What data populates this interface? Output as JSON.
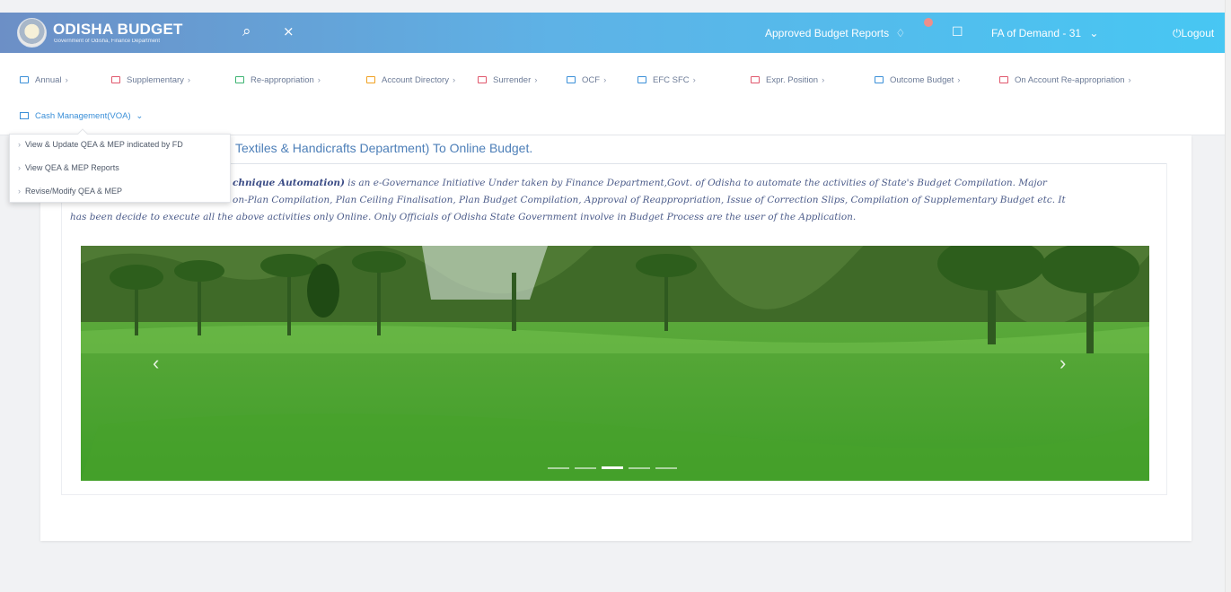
{
  "header": {
    "brand_title": "ODISHA BUDGET",
    "brand_subtitle": "Government of Odisha, Finance Department",
    "approved_reports": "Approved Budget Reports",
    "user_menu": "FA of Demand - 31",
    "logout": "Logout"
  },
  "nav": {
    "items": [
      {
        "label": "Annual",
        "color": "#3a8fd8"
      },
      {
        "label": "Supplementary",
        "color": "#e0566b"
      },
      {
        "label": "Re-appropriation",
        "color": "#3cb371"
      },
      {
        "label": "Account Directory",
        "color": "#f0a020"
      },
      {
        "label": "Surrender",
        "color": "#e0566b"
      },
      {
        "label": "OCF",
        "color": "#3a8fd8"
      },
      {
        "label": "EFC SFC",
        "color": "#3a8fd8"
      },
      {
        "label": "Expr. Position",
        "color": "#e0566b"
      },
      {
        "label": "Outcome Budget",
        "color": "#3a8fd8"
      },
      {
        "label": "On Account Re-appropriation",
        "color": "#e0566b"
      }
    ],
    "cash_management": "Cash Management(VOA)"
  },
  "dropdown": {
    "items": [
      "View & Update QEA & MEP indicated by FD",
      "View QEA & MEP Reports",
      "Revise/Modify QEA & MEP"
    ]
  },
  "main": {
    "welcome": "Textiles & Handicrafts Department) To Online Budget.",
    "intro_bold": "chnique Automation)",
    "intro_line1": " is an e-Governance Initiative Under taken by Finance Department,Govt. of Odisha to automate the activities of State's Budget Compilation. Major",
    "intro_line2": "on-Plan Compilation, Plan Ceiling Finalisation, Plan Budget Compilation, Approval of Reappropriation, Issue of Correction Slips, Compilation of Supplementary Budget etc. It",
    "intro_line3": "has been decide to execute all the above activities only Online. Only Officials of Odisha State Government involve in Budget Process are the user of the Application."
  },
  "carousel": {
    "prev_icon": "chevron-left-icon",
    "next_icon": "chevron-right-icon",
    "slide_count": 5,
    "active_slide": 3
  }
}
